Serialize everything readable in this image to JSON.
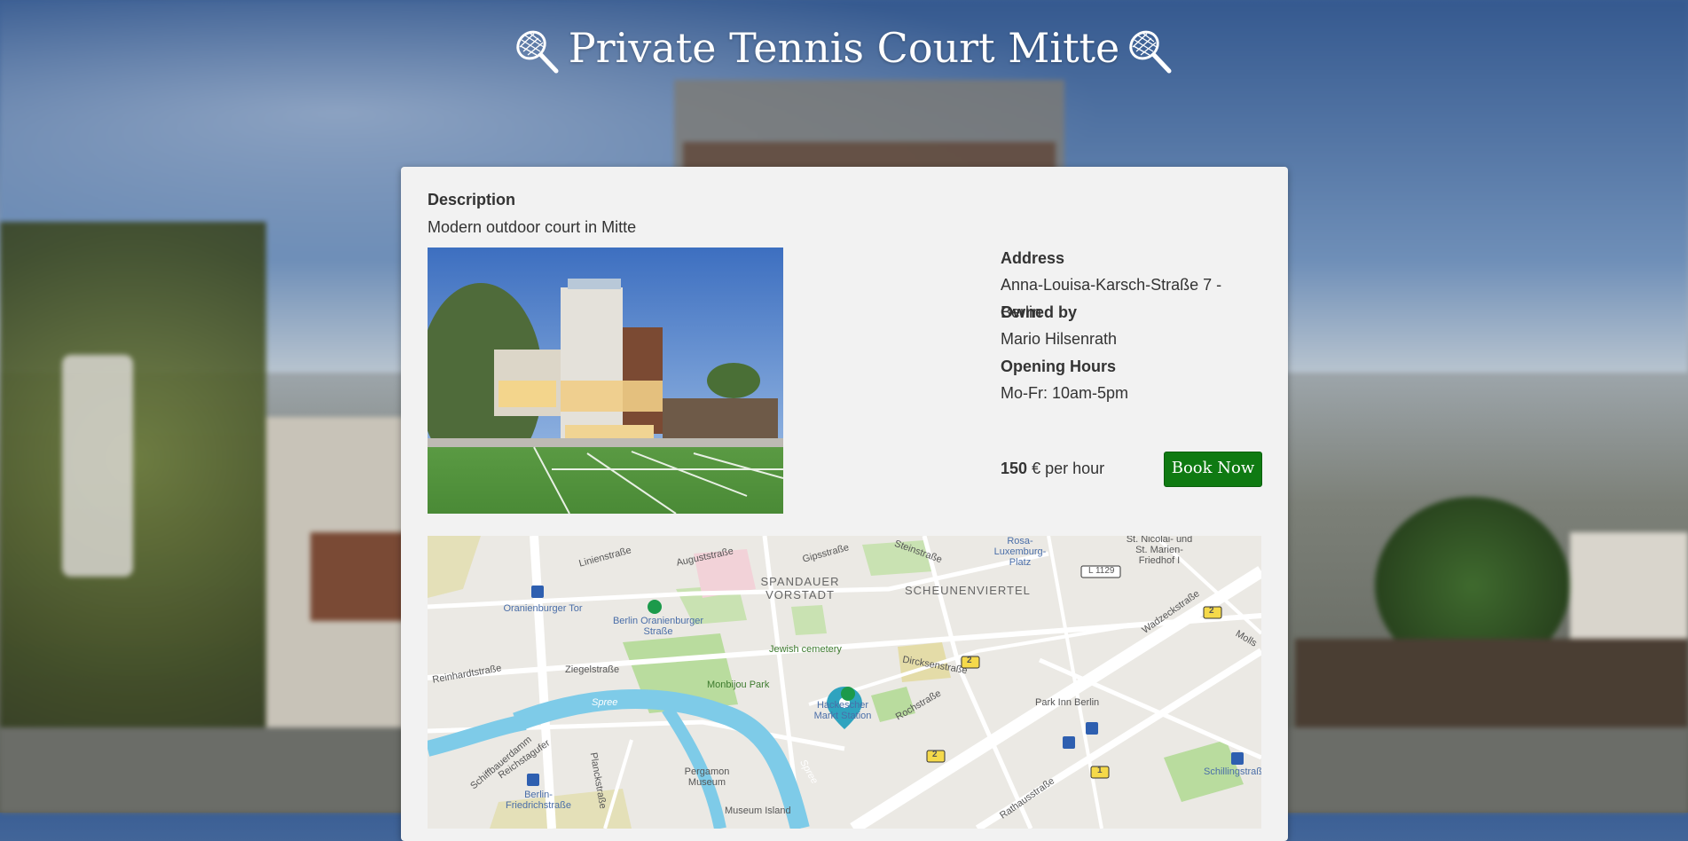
{
  "page": {
    "title": "Private Tennis Court Mitte",
    "title_icon": "tennis-racket-icon"
  },
  "card": {
    "description_label": "Description",
    "description_text": "Modern outdoor court in Mitte",
    "address_label": "Address",
    "address_value": "Anna-Louisa-Karsch-Straße 7 - Berlin",
    "owner_label": "Owned by",
    "owner_value": "Mario Hilsenrath",
    "hours_label": "Opening Hours",
    "hours_value": "Mo-Fr: 10am-5pm",
    "price_amount": "150",
    "price_suffix": "€ per hour",
    "book_label": "Book Now"
  },
  "map": {
    "labels": {
      "linienstrasse": "Linienstraße",
      "auguststrasse": "Auguststraße",
      "gipsstrasse": "Gipsstraße",
      "steinstrasse": "Steinstraße",
      "rosa_luxemburg": "Rosa-Luxemburg-Platz",
      "st_nicolai": "St. Nicolai- und St. Marien-Friedhof I",
      "spandauer": "SPANDAUER VORSTADT",
      "scheunenviertel": "SCHEUNENVIERTEL",
      "l1129": "L 1129",
      "wadzeckstrasse": "Wadzeckstraße",
      "oranienburger_tor": "Oranienburger Tor",
      "berlin_oranienburger": "Berlin Oranienburger Straße",
      "jewish_cemetery": "Jewish cemetery",
      "reinhardtstrasse": "Reinhardtstraße",
      "ziegelstrasse": "Ziegelstraße",
      "monbijou": "Monbijou Park",
      "dircksenstrasse": "Dircksenstraße",
      "hackescher": "Hackescher Markt Station",
      "rochstrasse": "Rochstraße",
      "park_inn": "Park Inn Berlin",
      "spree1": "Spree",
      "spree2": "Spree",
      "schiffbauerdamm": "Schiffbauerdamm",
      "reichstagufer": "Reichstagufer",
      "planckstrasse": "Planckstraße",
      "pergamon": "Pergamon Museum",
      "museum_island": "Museum Island",
      "berlin_friedrichstrasse": "Berlin-Friedrichstraße",
      "rathausstrasse": "Rathausstraße",
      "schillingstrasse": "Schillingstraße",
      "mollstrasse": "Molls",
      "road2a": "2",
      "road2b": "2",
      "road2c": "2",
      "road1": "1"
    },
    "colors": {
      "water": "#7ecbe8",
      "park": "#b9dc9e",
      "road": "#ffffff",
      "marker": "#2fa3bf"
    }
  },
  "colors": {
    "card_bg": "#f2f2f2",
    "book_button": "#0f7a12",
    "title_text": "#ffffff"
  }
}
